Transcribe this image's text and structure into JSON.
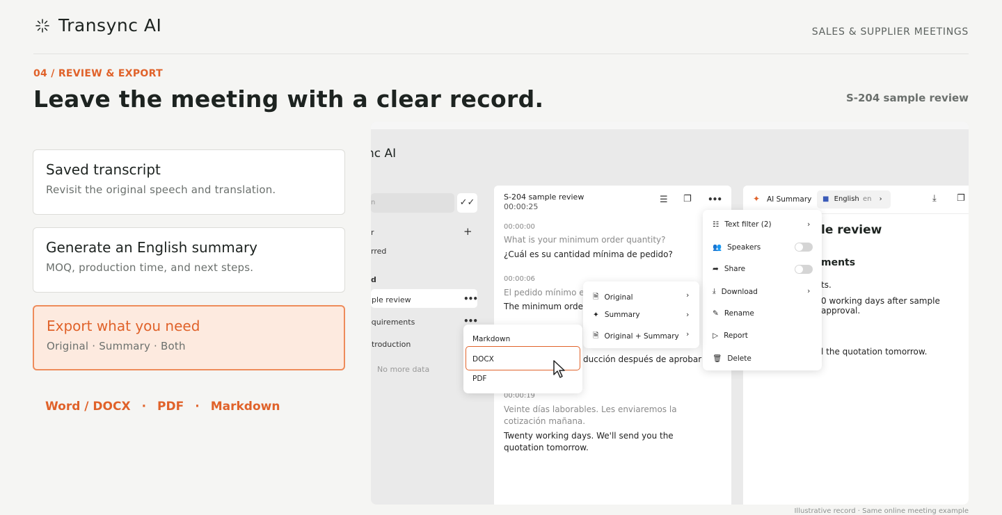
{
  "header": {
    "brand": "Transync AI",
    "category": "SALES & SUPPLIER MEETINGS",
    "step": "04 / REVIEW & EXPORT",
    "headline": "Leave the meeting with a clear record.",
    "sample_tag": "S-204 sample review"
  },
  "features": [
    {
      "title": "Saved transcript",
      "subtitle": "Revisit the original speech and translation."
    },
    {
      "title": "Generate an English summary",
      "subtitle": "MOQ, production time, and next steps."
    },
    {
      "title": "Export what you need",
      "subtitle": "Original · Summary · Both"
    }
  ],
  "formats": [
    "Word / DOCX",
    "·",
    "PDF",
    "·",
    "Markdown"
  ],
  "app": {
    "title": "nc AI",
    "search_placeholder": "n",
    "sidebar": {
      "row1": "r",
      "row2": "rred",
      "section": "d",
      "items": [
        "nple review",
        "equirements",
        "ntroduction"
      ],
      "empty": "No more data"
    },
    "transcript": {
      "title": "S-204 sample review",
      "duration": "00:00:25",
      "entries": [
        {
          "time": "00:00:00",
          "original": "What is your minimum order quantity?",
          "translation": "¿Cuál es su cantidad mínima de pedido?"
        },
        {
          "time": "00:00:06",
          "original": "El pedido mínimo es c",
          "translation": "The minimum order q"
        },
        {
          "time": "",
          "original": "",
          "translation": "ducción después de aprobar la"
        },
        {
          "time": "00:00:19",
          "original": "Veinte días laborables. Les enviaremos la cotización mañana.",
          "translation": "Twenty working days. We'll send you the quotation tomorrow."
        }
      ]
    },
    "summary": {
      "tab_label": "AI Summary",
      "language": "English",
      "language_code": "en",
      "heading": "le review",
      "section": "ments",
      "line1": "ts.",
      "line2": "0 working days after sample approval.",
      "line3": "l the quotation tomorrow."
    },
    "more_menu": {
      "text_filter": "Text filter (2)",
      "speakers": "Speakers",
      "share": "Share",
      "download": "Download",
      "rename": "Rename",
      "report": "Report",
      "delete": "Delete"
    },
    "download_menu": {
      "original": "Original",
      "summary": "Summary",
      "both": "Original + Summary"
    },
    "format_menu": {
      "markdown": "Markdown",
      "docx": "DOCX",
      "pdf": "PDF"
    }
  },
  "footnote": "Illustrative record · Same online meeting example",
  "colors": {
    "accent": "#e0622a",
    "accent_bg": "#fdeadf",
    "background": "#f5f5f3"
  }
}
